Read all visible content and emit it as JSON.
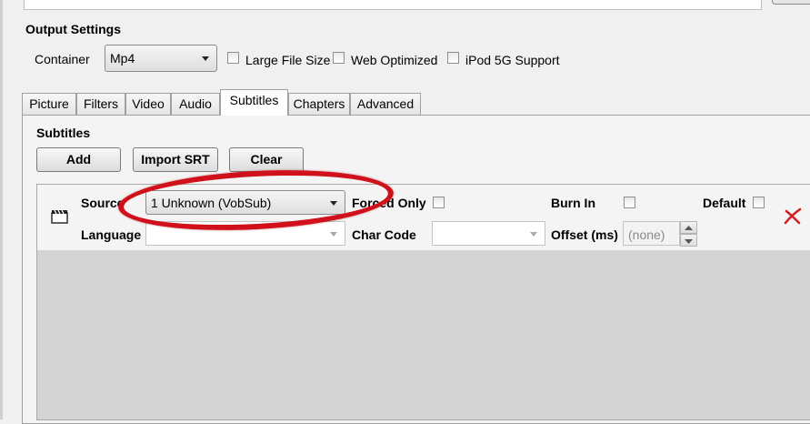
{
  "output_settings": {
    "title": "Output Settings",
    "container_label": "Container",
    "container_value": "Mp4",
    "large_file_size": "Large File Size",
    "web_optimized": "Web Optimized",
    "ipod_support": "iPod 5G Support"
  },
  "tabs": [
    {
      "label": "Picture"
    },
    {
      "label": "Filters"
    },
    {
      "label": "Video"
    },
    {
      "label": "Audio"
    },
    {
      "label": "Subtitles"
    },
    {
      "label": "Chapters"
    },
    {
      "label": "Advanced"
    }
  ],
  "subtitles": {
    "title": "Subtitles",
    "add": "Add",
    "import_srt": "Import SRT",
    "clear": "Clear",
    "row": {
      "source_label": "Source",
      "source_value": "1 Unknown (VobSub)",
      "forced_only": "Forced Only",
      "burn_in": "Burn In",
      "default": "Default",
      "language_label": "Language",
      "char_code_label": "Char Code",
      "offset_label": "Offset (ms)",
      "offset_placeholder": "(none)"
    }
  },
  "icons": {
    "subtitle_track": "clapperboard-icon",
    "remove": "remove-x-icon"
  },
  "colors": {
    "highlight_ellipse": "#d0101a",
    "remove_icon": "#d42020"
  }
}
